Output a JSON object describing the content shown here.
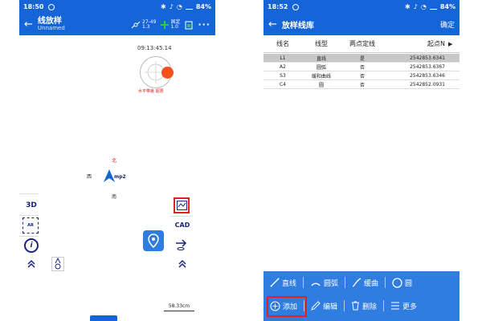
{
  "left_phone": {
    "status": {
      "time": "18:50",
      "battery": "84%"
    },
    "title": "线放样",
    "subtitle": "Unnamed",
    "toolbar": {
      "sat_count": "27-49",
      "sat_ratio": "1.3",
      "fix_status": "固定",
      "fix_value": "1.0",
      "more": "···"
    },
    "clock": "09:13:45.14",
    "gauge_label": "水平带差 超限",
    "compass": {
      "north": "北",
      "west": "西",
      "south": "南",
      "brand": "mp2"
    },
    "left_buttons": {
      "three_d": "3D",
      "ar": "AR",
      "info": "i"
    },
    "right_buttons": {
      "cad": "CAD"
    },
    "scale": "58.33cm"
  },
  "right_phone": {
    "status": {
      "time": "18:52",
      "battery": "84%"
    },
    "title": "放样线库",
    "confirm": "确定",
    "table": {
      "headers": [
        "线名",
        "线型",
        "两点定线",
        "起点N"
      ],
      "rows": [
        [
          "L1",
          "直线",
          "是",
          "2542853.6341"
        ],
        [
          "A2",
          "圆弧",
          "否",
          "2542853.6367"
        ],
        [
          "S3",
          "缓和曲线",
          "否",
          "2542853.6346"
        ],
        [
          "C4",
          "圆",
          "否",
          "2542852.0931"
        ]
      ],
      "selected_index": 0
    },
    "bottom_toolbar": {
      "row1": [
        "直线",
        "圆弧",
        "缓曲",
        "圆"
      ],
      "row2": [
        "添加",
        "编辑",
        "删除",
        "更多"
      ]
    }
  }
}
